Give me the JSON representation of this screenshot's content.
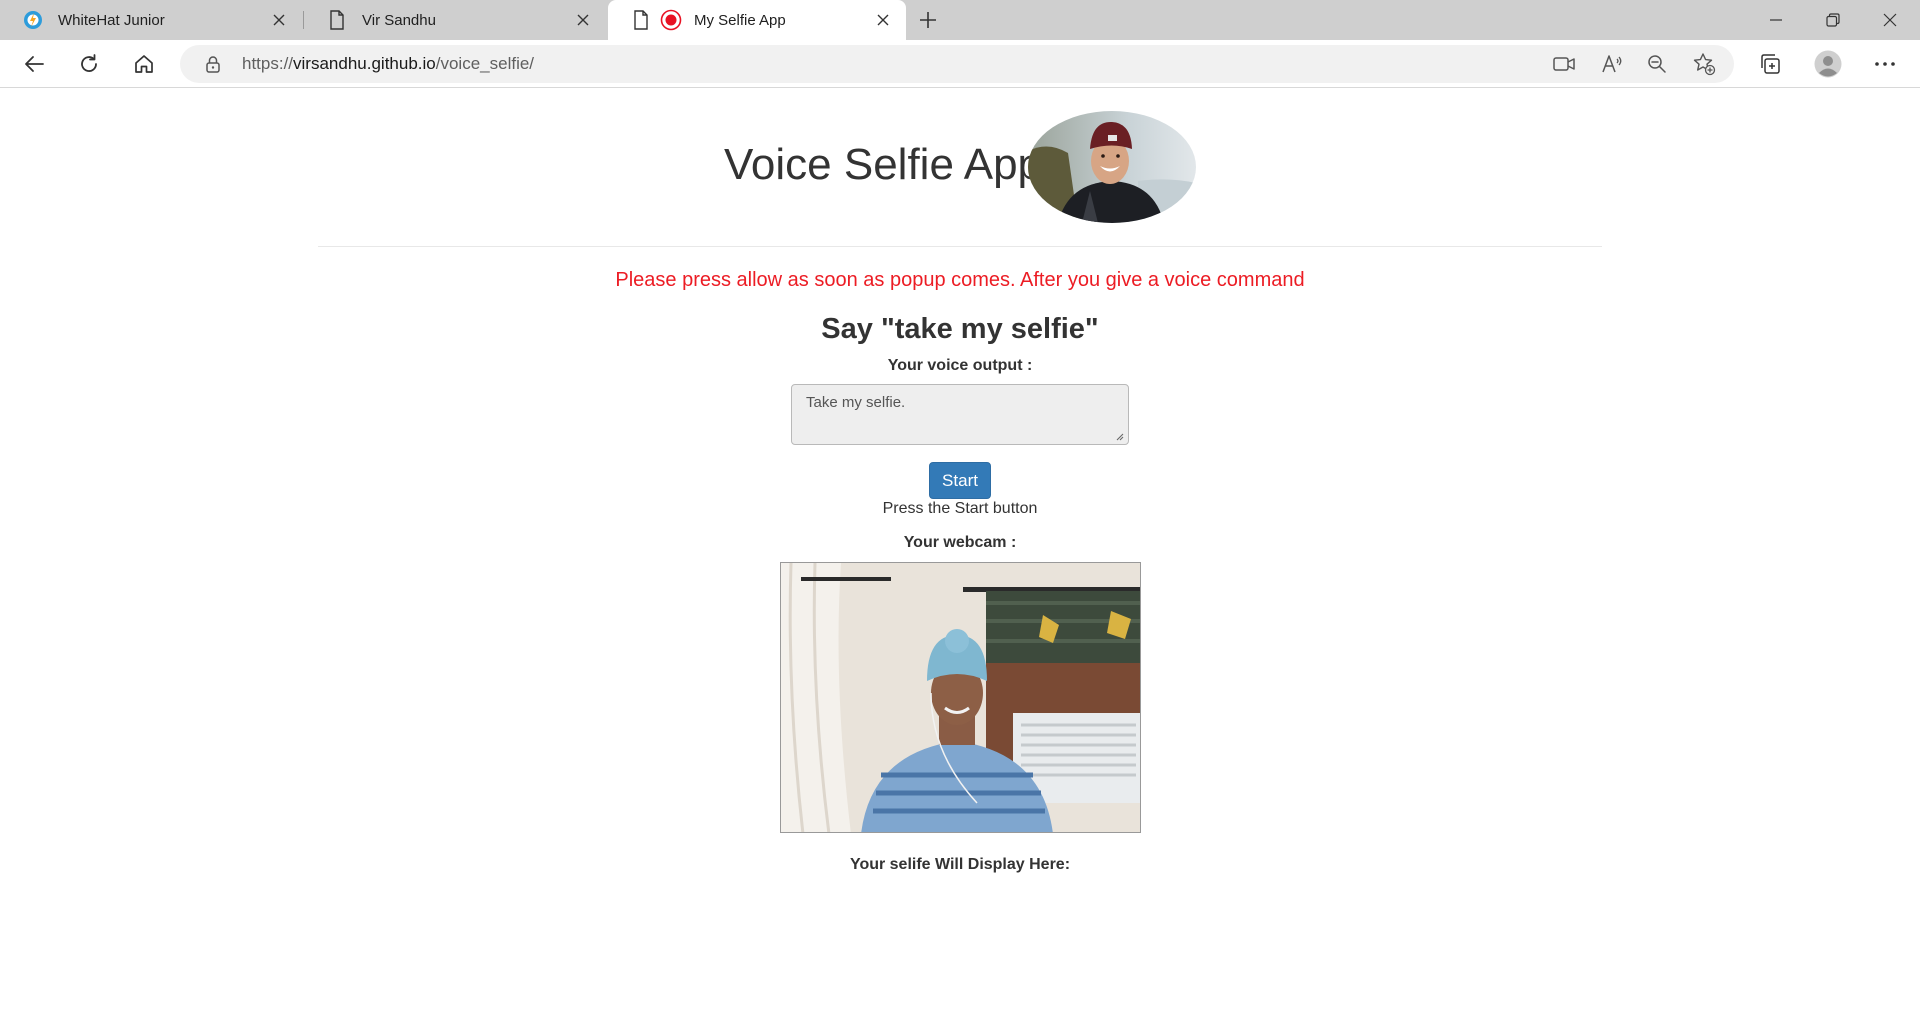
{
  "browser": {
    "tabs": [
      {
        "title": "WhiteHat Junior",
        "icon": "whitehat-logo-icon",
        "active": false
      },
      {
        "title": "Vir Sandhu",
        "icon": "document-icon",
        "active": false
      },
      {
        "title": "My Selfie App",
        "icon": "recording-icon",
        "active": true
      }
    ],
    "url_prefix": "https://",
    "url_host": "virsandhu.github.io",
    "url_path": "/voice_selfie/"
  },
  "page": {
    "title": "Voice Selfie App",
    "notice": "Please press allow as soon as popup comes. After you give a voice command",
    "instruction": "Say \"take my selfie\"",
    "voice_label": "Your voice output :",
    "voice_output": "Take my selfie.",
    "start_label": "Start",
    "status": "Press the Start button",
    "webcam_label": "Your webcam :",
    "selfie_label": "Your selife Will Display Here:"
  },
  "colors": {
    "notice": "#ec1c24",
    "button": "#337ab7",
    "record": "#e81123"
  }
}
